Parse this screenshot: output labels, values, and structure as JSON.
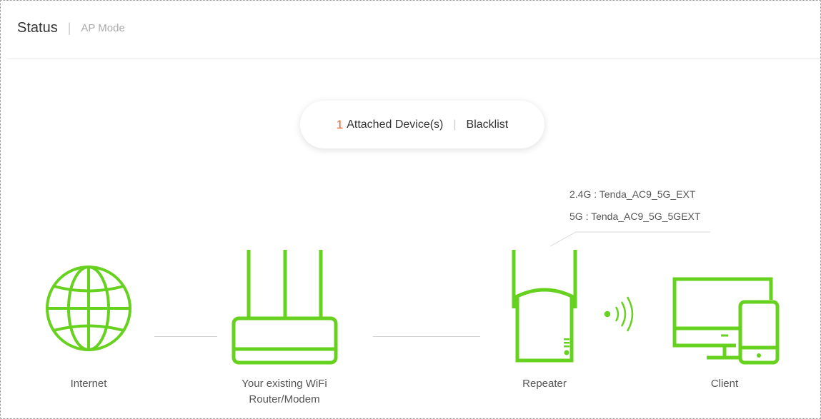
{
  "header": {
    "status_tab": "Status",
    "mode_tab": "AP Mode"
  },
  "devices": {
    "count": "1",
    "attached_label": "Attached Device(s)",
    "blacklist_label": "Blacklist"
  },
  "ssid": {
    "band_24": "2.4G :",
    "name_24": "Tenda_AC9_5G_EXT",
    "band_5": "5G :",
    "name_5": "Tenda_AC9_5G_5GEXT"
  },
  "topology": {
    "internet_label": "Internet",
    "router_label_line1": "Your existing WiFi",
    "router_label_line2": "Router/Modem",
    "repeater_label": "Repeater",
    "client_label": "Client"
  },
  "colors": {
    "accent_green": "#66d11e",
    "count_orange": "#ff5a1f"
  },
  "icons": [
    "globe-icon",
    "router-icon",
    "repeater-icon",
    "wifi-signal-icon",
    "monitor-icon",
    "phone-icon"
  ]
}
